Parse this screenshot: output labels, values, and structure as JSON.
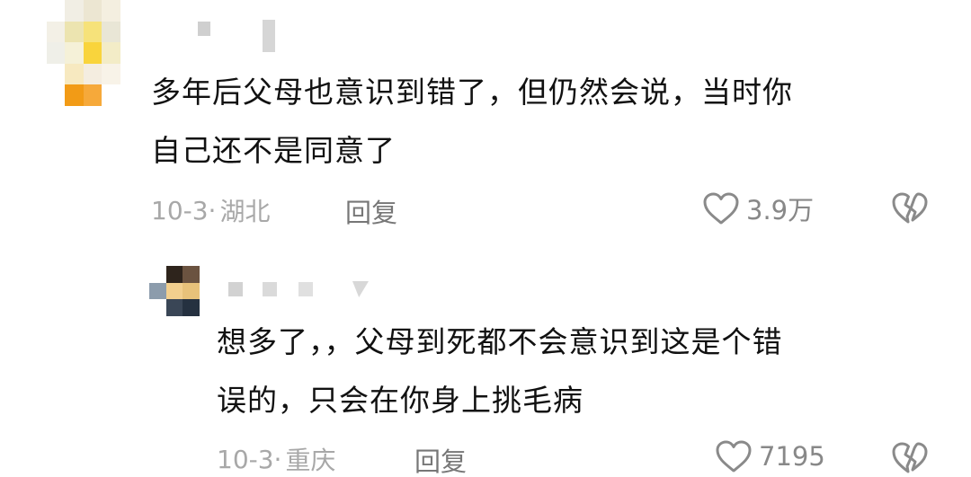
{
  "comments": [
    {
      "text_lines": [
        "多年后父母也意识到错了，但仍然会说，当时你",
        "自己还不是同意了"
      ],
      "date": "10-3·",
      "location": "湖北",
      "reply_label": "回复",
      "like_count": "3.9万",
      "icons": {
        "like": "heart-outline-icon",
        "dislike": "broken-heart-icon"
      }
    },
    {
      "text_lines": [
        "想多了，，父母到死都不会意识到这是个错",
        "误的，只会在你身上挑毛病"
      ],
      "date": "10-3·",
      "location": "重庆",
      "reply_label": "回复",
      "like_count": "7195",
      "icons": {
        "like": "heart-outline-icon",
        "dislike": "broken-heart-icon"
      }
    }
  ],
  "colors": {
    "text": "#111111",
    "meta": "#a8a8a8",
    "icon": "#8a8a8a",
    "background": "#ffffff"
  }
}
